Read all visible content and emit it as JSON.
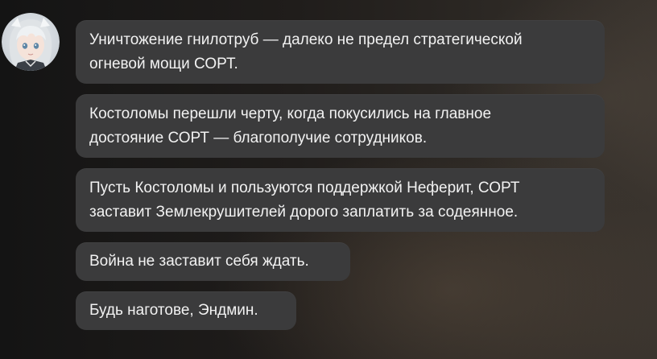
{
  "speaker": {
    "avatar_icon": "character-portrait-white-hair"
  },
  "messages": [
    {
      "text": "Уничтожение гнилотруб — далеко не предел стратегической\nогневой мощи СОРТ."
    },
    {
      "text": "Костоломы перешли черту, когда покусились на главное\nдостояние СОРТ — благополучие сотрудников."
    },
    {
      "text": "Пусть Костоломы и пользуются поддержкой Неферит, СОРТ\nзаставит Землекрушителей дорого заплатить за содеянное."
    },
    {
      "text": "Война не заставит себя ждать."
    },
    {
      "text": "Будь наготове, Эндмин."
    }
  ],
  "colors": {
    "bubble_bg": "#3b3b3c",
    "text": "#f2f2f2"
  }
}
